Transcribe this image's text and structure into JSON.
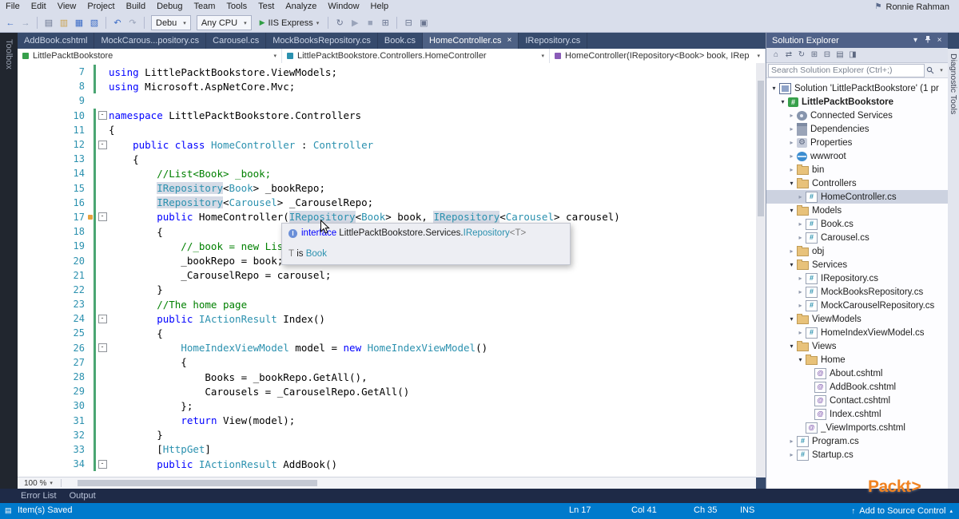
{
  "window": {
    "user": "Ronnie Rahman"
  },
  "menu": {
    "items": [
      "File",
      "Edit",
      "View",
      "Project",
      "Build",
      "Debug",
      "Team",
      "Tools",
      "Test",
      "Analyze",
      "Window",
      "Help"
    ]
  },
  "toolbar": {
    "items": [
      {
        "glyph": "←",
        "name": "nav-back-icon",
        "color": "#3a6bc6"
      },
      {
        "glyph": "→",
        "name": "nav-forward-icon",
        "color": "#93a0b8"
      },
      {
        "type": "sep"
      },
      {
        "glyph": "▤",
        "name": "new-file-icon",
        "color": "#6a7590"
      },
      {
        "glyph": "▥",
        "name": "open-file-icon",
        "color": "#c9a14e"
      },
      {
        "glyph": "▦",
        "name": "save-icon",
        "color": "#3a6bc6"
      },
      {
        "glyph": "▧",
        "name": "save-all-icon",
        "color": "#3a6bc6"
      },
      {
        "type": "sep"
      },
      {
        "glyph": "↶",
        "name": "undo-icon",
        "color": "#3a6bc6"
      },
      {
        "glyph": "↷",
        "name": "redo-icon",
        "color": "#9aa4ba"
      },
      {
        "type": "sep"
      },
      {
        "type": "dd",
        "label": "Debu",
        "name": "configuration-dropdown"
      },
      {
        "type": "dd",
        "label": "Any CPU",
        "name": "platform-dropdown"
      },
      {
        "type": "run",
        "label": "IIS Express",
        "name": "start-debug-button"
      },
      {
        "type": "sep"
      },
      {
        "glyph": "↻",
        "name": "refresh-icon",
        "color": "#6a7590"
      },
      {
        "glyph": "▶",
        "name": "start-without-debug-icon",
        "color": "#9aa4ba"
      },
      {
        "glyph": "■",
        "name": "stop-icon",
        "color": "#9aa4ba"
      },
      {
        "glyph": "⊞",
        "name": "window-layout-icon",
        "color": "#6a7590"
      },
      {
        "type": "sep"
      },
      {
        "glyph": "⊟",
        "name": "find-in-files-icon",
        "color": "#6a7590"
      },
      {
        "glyph": "▣",
        "name": "command-window-icon",
        "color": "#6a7590"
      }
    ]
  },
  "tabs": [
    {
      "label": "AddBook.cshtml",
      "active": false
    },
    {
      "label": "MockCarous...pository.cs",
      "active": false
    },
    {
      "label": "Carousel.cs",
      "active": false
    },
    {
      "label": "MockBooksRepository.cs",
      "active": false
    },
    {
      "label": "Book.cs",
      "active": false
    },
    {
      "label": "HomeController.cs",
      "active": true
    },
    {
      "label": "IRepository.cs",
      "active": false
    }
  ],
  "breadcrumb": {
    "project": "LittlePacktBookstore",
    "type_path": "LittlePacktBookstore.Controllers.HomeController",
    "member": "HomeController(IRepository<Book> book, IRepository<"
  },
  "editor": {
    "zoom": "100 %",
    "tooltip": {
      "keyword": "interface",
      "qualifier": " LittlePacktBookstore.Services.",
      "type_name": "IRepository",
      "generic": "<T>",
      "param": "T",
      "verb": " is ",
      "arg": "Book"
    },
    "lines": [
      {
        "n": 7,
        "bar": true,
        "s": [
          [
            "kw",
            "using"
          ],
          [
            "pl",
            " LittlePacktBookstore.ViewModels;"
          ]
        ]
      },
      {
        "n": 8,
        "bar": true,
        "s": [
          [
            "kw",
            "using"
          ],
          [
            "pl",
            " Microsoft.AspNetCore.Mvc;"
          ]
        ]
      },
      {
        "n": 9,
        "bar": false,
        "s": []
      },
      {
        "n": 10,
        "bar": true,
        "fold": true,
        "s": [
          [
            "kw",
            "namespace"
          ],
          [
            "pl",
            " LittlePacktBookstore.Controllers"
          ]
        ]
      },
      {
        "n": 11,
        "bar": true,
        "s": [
          [
            "pl",
            "{"
          ]
        ]
      },
      {
        "n": 12,
        "bar": true,
        "fold": true,
        "s": [
          [
            "pl",
            "    "
          ],
          [
            "kw",
            "public"
          ],
          [
            "pl",
            " "
          ],
          [
            "kw",
            "class"
          ],
          [
            "pl",
            " "
          ],
          [
            "ty",
            "HomeController"
          ],
          [
            "pl",
            " : "
          ],
          [
            "ty",
            "Controller"
          ]
        ]
      },
      {
        "n": 13,
        "bar": true,
        "s": [
          [
            "pl",
            "    {"
          ]
        ]
      },
      {
        "n": 14,
        "bar": true,
        "s": [
          [
            "cm",
            "        //List<Book> _book;"
          ]
        ]
      },
      {
        "n": 15,
        "bar": true,
        "s": [
          [
            "pl",
            "        "
          ],
          [
            "hl",
            "IRepository"
          ],
          [
            "pl",
            "<"
          ],
          [
            "ty",
            "Book"
          ],
          [
            "pl",
            "> _bookRepo;"
          ]
        ]
      },
      {
        "n": 16,
        "bar": true,
        "s": [
          [
            "pl",
            "        "
          ],
          [
            "hl",
            "IRepository"
          ],
          [
            "pl",
            "<"
          ],
          [
            "ty",
            "Carousel"
          ],
          [
            "pl",
            "> _CarouselRepo;"
          ]
        ]
      },
      {
        "n": 17,
        "bar": true,
        "fold": true,
        "mark": true,
        "s": [
          [
            "pl",
            "        "
          ],
          [
            "kw",
            "public"
          ],
          [
            "pl",
            " HomeController("
          ],
          [
            "hl",
            "IRepository"
          ],
          [
            "pl",
            "<"
          ],
          [
            "ty",
            "Book"
          ],
          [
            "pl",
            "> book, "
          ],
          [
            "hl",
            "IRepository"
          ],
          [
            "pl",
            "<"
          ],
          [
            "ty",
            "Carousel"
          ],
          [
            "pl",
            "> carousel)"
          ]
        ]
      },
      {
        "n": 18,
        "bar": true,
        "s": [
          [
            "pl",
            "        {"
          ]
        ]
      },
      {
        "n": 19,
        "bar": true,
        "s": [
          [
            "cm",
            "            //_book = new List<Book>();"
          ]
        ]
      },
      {
        "n": 20,
        "bar": true,
        "s": [
          [
            "pl",
            "            _bookRepo = book;"
          ]
        ]
      },
      {
        "n": 21,
        "bar": true,
        "s": [
          [
            "pl",
            "            _CarouselRepo = carousel;"
          ]
        ]
      },
      {
        "n": 22,
        "bar": true,
        "s": [
          [
            "pl",
            "        }"
          ]
        ]
      },
      {
        "n": 23,
        "bar": true,
        "s": [
          [
            "cm",
            "        //The home page"
          ]
        ]
      },
      {
        "n": 24,
        "bar": true,
        "fold": true,
        "s": [
          [
            "pl",
            "        "
          ],
          [
            "kw",
            "public"
          ],
          [
            "pl",
            " "
          ],
          [
            "ty",
            "IActionResult"
          ],
          [
            "pl",
            " Index()"
          ]
        ]
      },
      {
        "n": 25,
        "bar": true,
        "s": [
          [
            "pl",
            "        {"
          ]
        ]
      },
      {
        "n": 26,
        "bar": true,
        "fold": true,
        "s": [
          [
            "pl",
            "            "
          ],
          [
            "ty",
            "HomeIndexViewModel"
          ],
          [
            "pl",
            " model = "
          ],
          [
            "kw",
            "new"
          ],
          [
            "pl",
            " "
          ],
          [
            "ty",
            "HomeIndexViewModel"
          ],
          [
            "pl",
            "()"
          ]
        ]
      },
      {
        "n": 27,
        "bar": true,
        "s": [
          [
            "pl",
            "            {"
          ]
        ]
      },
      {
        "n": 28,
        "bar": true,
        "s": [
          [
            "pl",
            "                Books = _bookRepo.GetAll(),"
          ]
        ]
      },
      {
        "n": 29,
        "bar": true,
        "s": [
          [
            "pl",
            "                Carousels = _CarouselRepo.GetAll()"
          ]
        ]
      },
      {
        "n": 30,
        "bar": true,
        "s": [
          [
            "pl",
            "            };"
          ]
        ]
      },
      {
        "n": 31,
        "bar": true,
        "s": [
          [
            "pl",
            "            "
          ],
          [
            "kw",
            "return"
          ],
          [
            "pl",
            " View(model);"
          ]
        ]
      },
      {
        "n": 32,
        "bar": true,
        "s": [
          [
            "pl",
            "        }"
          ]
        ]
      },
      {
        "n": 33,
        "bar": true,
        "s": [
          [
            "pl",
            "        ["
          ],
          [
            "ty",
            "HttpGet"
          ],
          [
            "pl",
            "]"
          ]
        ]
      },
      {
        "n": 34,
        "bar": true,
        "fold": true,
        "s": [
          [
            "pl",
            "        "
          ],
          [
            "kw",
            "public"
          ],
          [
            "pl",
            " "
          ],
          [
            "ty",
            "IActionResult"
          ],
          [
            "pl",
            " AddBook()"
          ]
        ]
      }
    ]
  },
  "solution_explorer": {
    "title": "Solution Explorer",
    "search_placeholder": "Search Solution Explorer (Ctrl+;)",
    "toolbar_icons": [
      {
        "glyph": "⌂",
        "name": "home-icon",
        "color": "#5d6880"
      },
      {
        "glyph": "⇄",
        "name": "switch-views-icon",
        "color": "#5d6880"
      },
      {
        "glyph": "↻",
        "name": "refresh-icon",
        "color": "#5d6880"
      },
      {
        "glyph": "⊞",
        "name": "show-all-files-icon",
        "color": "#5d6880"
      },
      {
        "glyph": "⊟",
        "name": "collapse-all-icon",
        "color": "#5d6880"
      },
      {
        "glyph": "▤",
        "name": "properties-icon",
        "color": "#5d6880"
      },
      {
        "glyph": "◨",
        "name": "preview-selected-icon",
        "color": "#5d6880"
      }
    ],
    "tree": [
      {
        "label": "Solution 'LittlePacktBookstore' (1 pr",
        "level": 0,
        "exp": "open",
        "icon": "sln"
      },
      {
        "label": "LittlePacktBookstore",
        "level": 1,
        "exp": "open",
        "icon": "proj",
        "bold": true
      },
      {
        "label": "Connected Services",
        "level": 2,
        "exp": "closed",
        "icon": "svc"
      },
      {
        "label": "Dependencies",
        "level": 2,
        "exp": "closed",
        "icon": "dep"
      },
      {
        "label": "Properties",
        "level": 2,
        "exp": "closed",
        "icon": "props"
      },
      {
        "label": "wwwroot",
        "level": 2,
        "exp": "closed",
        "icon": "www"
      },
      {
        "label": "bin",
        "level": 2,
        "exp": "closed",
        "icon": "folder"
      },
      {
        "label": "Controllers",
        "level": 2,
        "exp": "open",
        "icon": "folder"
      },
      {
        "label": "HomeController.cs",
        "level": 3,
        "exp": "closed",
        "icon": "cs",
        "selected": true
      },
      {
        "label": "Models",
        "level": 2,
        "exp": "open",
        "icon": "folder"
      },
      {
        "label": "Book.cs",
        "level": 3,
        "exp": "closed",
        "icon": "cs"
      },
      {
        "label": "Carousel.cs",
        "level": 3,
        "exp": "closed",
        "icon": "cs"
      },
      {
        "label": "obj",
        "level": 2,
        "exp": "closed",
        "icon": "folder"
      },
      {
        "label": "Services",
        "level": 2,
        "exp": "open",
        "icon": "folder"
      },
      {
        "label": "IRepository.cs",
        "level": 3,
        "exp": "closed",
        "icon": "cs"
      },
      {
        "label": "MockBooksRepository.cs",
        "level": 3,
        "exp": "closed",
        "icon": "cs"
      },
      {
        "label": "MockCarouselRepository.cs",
        "level": 3,
        "exp": "closed",
        "icon": "cs"
      },
      {
        "label": "ViewModels",
        "level": 2,
        "exp": "open",
        "icon": "folder"
      },
      {
        "label": "HomeIndexViewModel.cs",
        "level": 3,
        "exp": "closed",
        "icon": "cs"
      },
      {
        "label": "Views",
        "level": 2,
        "exp": "open",
        "icon": "folder"
      },
      {
        "label": "Home",
        "level": 3,
        "exp": "open",
        "icon": "folder"
      },
      {
        "label": "About.cshtml",
        "level": 4,
        "icon": "cshtml"
      },
      {
        "label": "AddBook.cshtml",
        "level": 4,
        "icon": "cshtml"
      },
      {
        "label": "Contact.cshtml",
        "level": 4,
        "icon": "cshtml"
      },
      {
        "label": "Index.cshtml",
        "level": 4,
        "icon": "cshtml"
      },
      {
        "label": "_ViewImports.cshtml",
        "level": 3,
        "icon": "cshtml"
      },
      {
        "label": "Program.cs",
        "level": 2,
        "exp": "closed",
        "icon": "cs"
      },
      {
        "label": "Startup.cs",
        "level": 2,
        "exp": "closed",
        "icon": "cs"
      }
    ]
  },
  "panels": {
    "left_tab": "Toolbox",
    "right_tab": "Diagnostic Tools",
    "bottom_tabs": [
      "Error List",
      "Output"
    ]
  },
  "status_bar": {
    "message": "Item(s) Saved",
    "line": "Ln 17",
    "col": "Col 41",
    "ch": "Ch 35",
    "mode": "INS",
    "source_control": "Add to Source Control"
  },
  "brand": {
    "logo_text": "Packt",
    "logo_mark": ">"
  },
  "colors": {
    "accent": "#007acc",
    "keyword": "#0000ff",
    "type": "#2b91af",
    "comment": "#008000",
    "symbol_highlight": "#d6dbe6",
    "change_bar": "#4aa572",
    "tab_strip": "#364a6c",
    "logo_orange": "#f08220"
  }
}
